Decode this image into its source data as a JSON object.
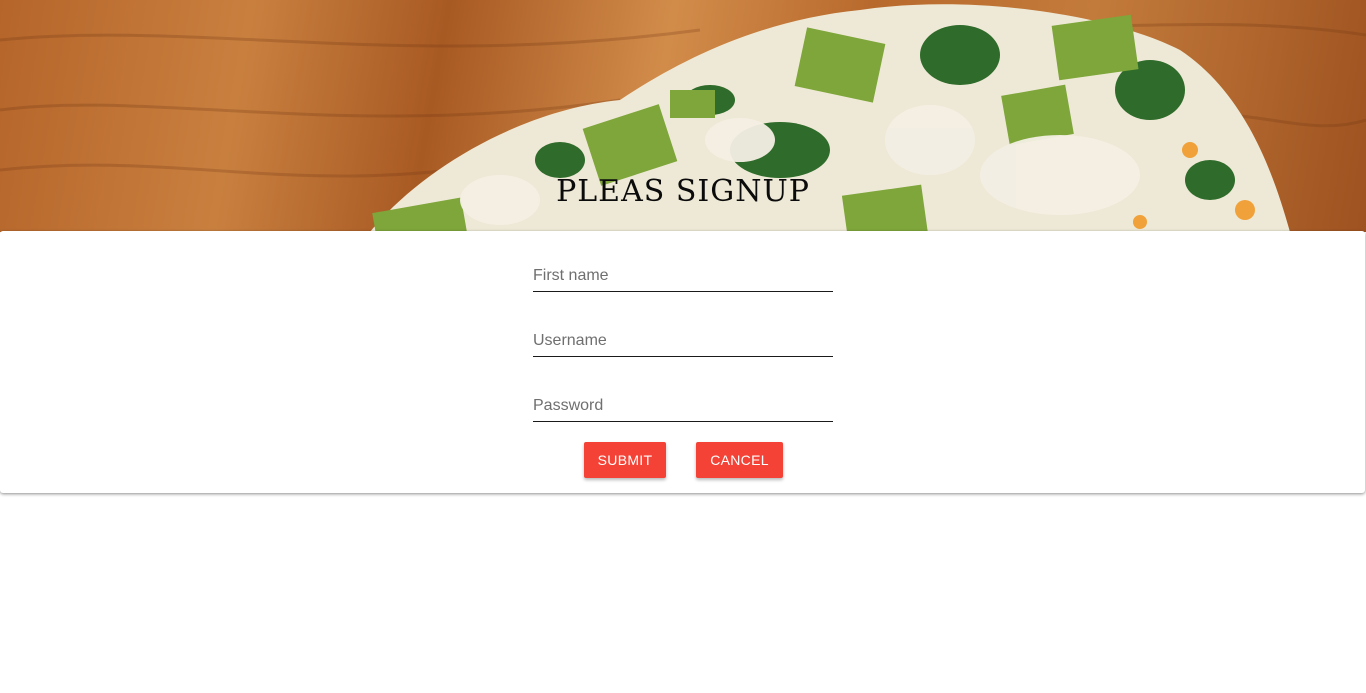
{
  "hero": {
    "title": "PLEAS SIGNUP"
  },
  "form": {
    "first_name_placeholder": "First name",
    "first_name_value": "",
    "username_placeholder": "Username",
    "username_value": "",
    "password_placeholder": "Password",
    "password_value": ""
  },
  "actions": {
    "submit_label": "SUBMIT",
    "cancel_label": "CANCEL"
  },
  "colors": {
    "accent": "#f44336",
    "text": "#0b0b0b",
    "placeholder": "#6f6f6f"
  }
}
